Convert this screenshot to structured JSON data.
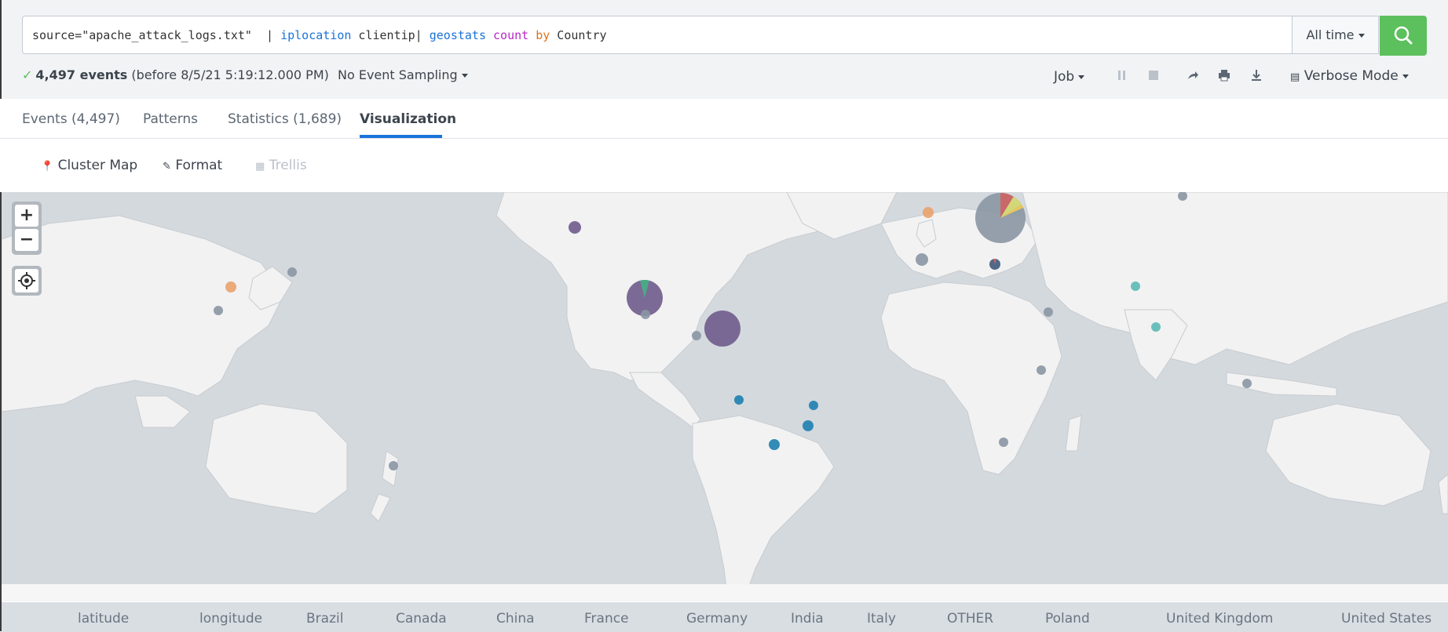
{
  "search": {
    "query_parts": [
      {
        "text": "source=\"apache_attack_logs.txt\"  | ",
        "kind": "plain"
      },
      {
        "text": "iplocation",
        "kind": "cmd"
      },
      {
        "text": " clientip| ",
        "kind": "plain"
      },
      {
        "text": "geostats",
        "kind": "cmd"
      },
      {
        "text": " ",
        "kind": "plain"
      },
      {
        "text": "count",
        "kind": "func"
      },
      {
        "text": " ",
        "kind": "plain"
      },
      {
        "text": "by",
        "kind": "kw"
      },
      {
        "text": " Country",
        "kind": "plain"
      }
    ],
    "time_range": "All time",
    "search_button_icon": "search-icon",
    "button_color": "#5cc05c"
  },
  "status": {
    "events": "4,497 events",
    "timestamp": "(before 8/5/21 5:19:12.000 PM)",
    "sampling": "No Event Sampling",
    "job": "Job",
    "mode": "Verbose Mode"
  },
  "tabs": [
    {
      "label": "Events (4,497)",
      "active": false
    },
    {
      "label": "Patterns",
      "active": false
    },
    {
      "label": "Statistics (1,689)",
      "active": false
    },
    {
      "label": "Visualization",
      "active": true
    }
  ],
  "viz_toolbar": {
    "type": "Cluster Map",
    "format": "Format",
    "trellis": "Trellis"
  },
  "map": {
    "zoom_in": "+",
    "zoom_out": "−",
    "ocean_color": "#d4d9de",
    "land_color": "#f2f2f2"
  },
  "legend": [
    "latitude",
    "longitude",
    "Brazil",
    "Canada",
    "China",
    "France",
    "Germany",
    "India",
    "Italy",
    "OTHER",
    "Poland",
    "United Kingdom",
    "United States"
  ],
  "colors": {
    "accent_blue": "#1a73d9",
    "us_purple": "#6f5b8c",
    "other_gray": "#8a96a3",
    "brazil_blue": "#1e7fb0",
    "india_teal": "#5bb9b5",
    "china_orange": "#e9a26c",
    "canada_green": "#4aa985",
    "germany_red": "#c96868",
    "poland_yellow": "#d4d777"
  }
}
